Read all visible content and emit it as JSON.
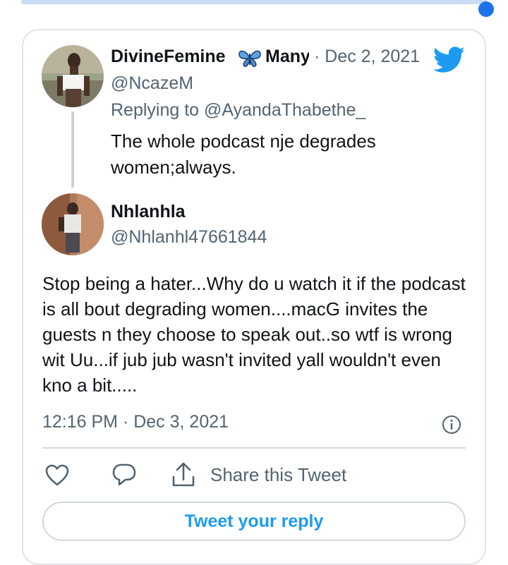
{
  "quoted_tweet": {
    "display_name": "DivineFemine",
    "display_name_suffix": "Many",
    "date": "· Dec 2, 2021",
    "handle": "@NcazeM",
    "replying_to": "Replying to @AyandaThabethe_",
    "text": "The whole podcast nje degrades women;always."
  },
  "main_tweet": {
    "display_name": "Nhlanhla",
    "handle": "@Nhlanhl47661844",
    "text": "Stop being a hater...Why do u watch it if the podcast is all bout degrading women....macG invites the guests n they choose to speak out..so wtf is wrong wit Uu...if jub jub wasn't invited yall wouldn't even kno a bit.....",
    "timestamp": "12:16 PM · Dec 3, 2021"
  },
  "actions": {
    "share_label": "Share this Tweet",
    "reply_button": "Tweet your reply"
  },
  "icons": [
    "butterfly-emoji-icon",
    "twitter-bird-icon",
    "info-icon",
    "heart-icon",
    "reply-icon",
    "share-icon"
  ],
  "colors": {
    "twitter_blue": "#1d9bf0",
    "secondary_text": "#536471",
    "border": "#cfd9de"
  }
}
